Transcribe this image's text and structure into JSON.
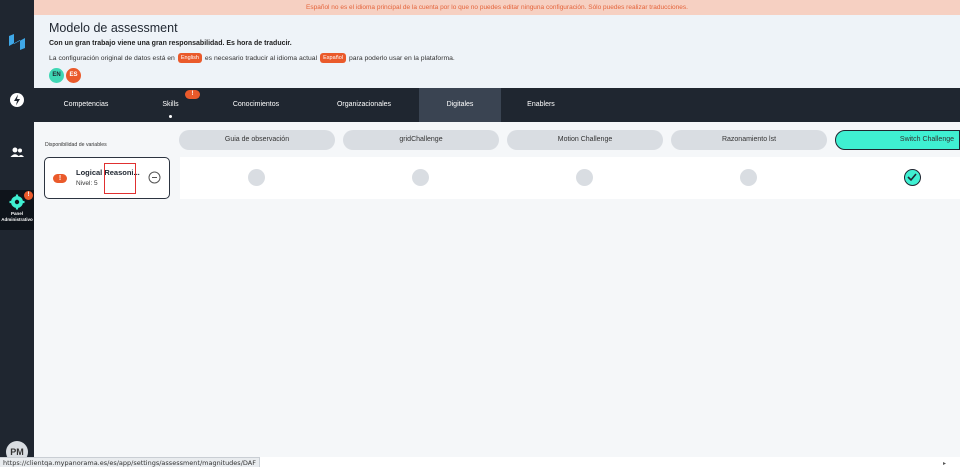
{
  "banner": {
    "text": "Español no es el idioma principal de la cuenta por lo que no puedes editar ninguna configuración. Sólo puedes realizar traducciones."
  },
  "header": {
    "title": "Modelo de assessment",
    "subtitle": "Con un gran trabajo viene una gran responsabilidad. Es hora de traducir.",
    "config_prefix": "La configuración original de datos está en",
    "original_lang": "English",
    "config_middle": "es necesario traducir al idioma actual",
    "current_lang": "Español",
    "config_suffix": "para poderlo usar en la plataforma.",
    "lang_pills": [
      "EN",
      "ES"
    ]
  },
  "tabs": [
    {
      "label": "Competencias"
    },
    {
      "label": "Skills",
      "badge": "!"
    },
    {
      "label": "Conocimientos"
    },
    {
      "label": "Organizacionales"
    },
    {
      "label": "Digitales",
      "active": true
    },
    {
      "label": "Enablers"
    }
  ],
  "content": {
    "availability_label": "Disponibilidad de variables",
    "challenges": [
      "Guia de observación",
      "gridChallenge",
      "Motion Challenge",
      "Razonamiento lst",
      "Switch Challenge"
    ],
    "active_challenge_index": 4,
    "variable": {
      "alert": "!",
      "name": "Logical Reasoni...",
      "level": "Nivel: 5"
    }
  },
  "sidebar": {
    "admin_label": "Panel Administrativo",
    "admin_badge": "!",
    "avatar": "PM",
    "icons": [
      "logo-icon",
      "bolt-icon",
      "users-icon",
      "gear-icon"
    ]
  },
  "status_bar": {
    "url": "https://clientqa.mypanorama.es/es/app/settings/assessment/magnitudes/DAF"
  },
  "colors": {
    "dark": "#1f2630",
    "accent_orange": "#ea5a2b",
    "accent_teal": "#3ff0d2",
    "pill_grey": "#d9dde2"
  }
}
